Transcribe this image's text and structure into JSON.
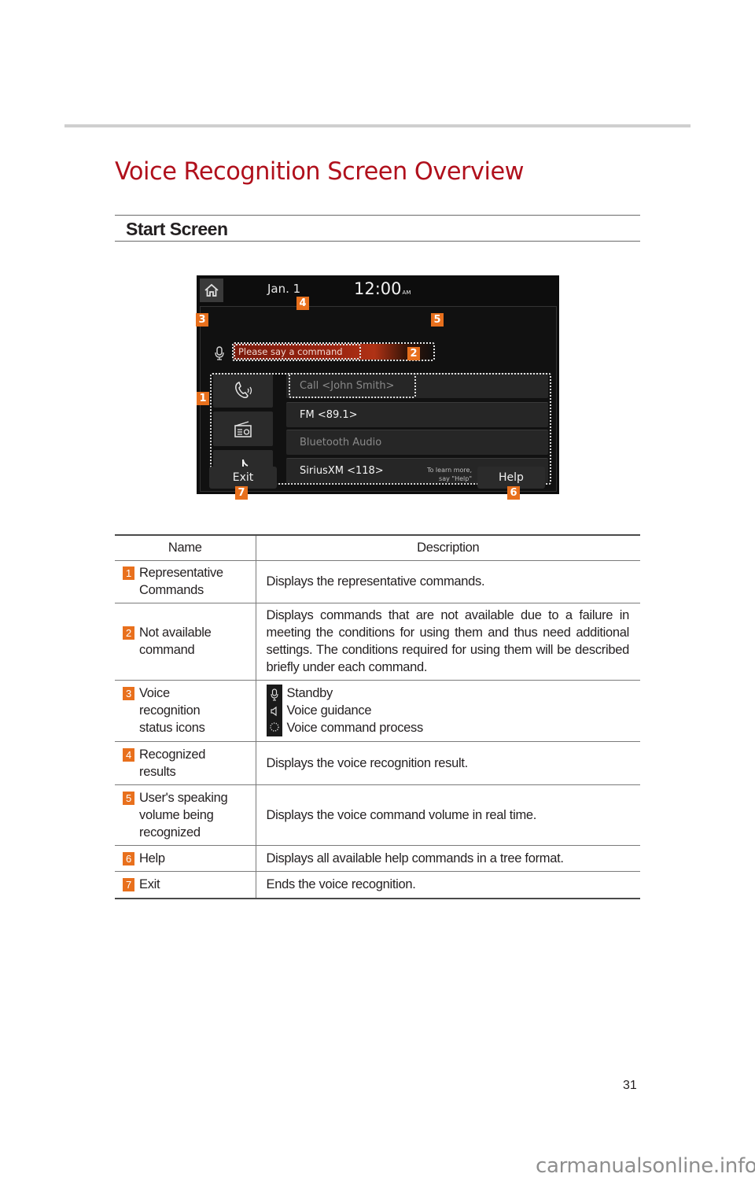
{
  "header": {
    "title": "Voice Recognition Screen Overview",
    "section": "Start Screen"
  },
  "screen": {
    "date": "Jan.  1",
    "time": "12:00",
    "ampm": "AM",
    "prompt": "Please say a command",
    "commands": [
      {
        "label": "Call <John Smith>",
        "state": "unavailable"
      },
      {
        "label": "FM <89.1>",
        "state": "available"
      },
      {
        "label": "Bluetooth Audio",
        "state": "unavailable"
      },
      {
        "label": "SiriusXM <118>",
        "state": "available"
      }
    ],
    "category_icons": [
      "phone-icon",
      "radio-icon",
      "music-note-icon"
    ],
    "exit_label": "Exit",
    "help_label": "Help",
    "hint_line1": "To learn more,",
    "hint_line2": "say \"Help\"",
    "callouts": [
      "1",
      "2",
      "3",
      "4",
      "5",
      "6",
      "7"
    ]
  },
  "table": {
    "headers": {
      "name": "Name",
      "description": "Description"
    },
    "rows": [
      {
        "num": "1",
        "name": "Representative Commands",
        "description": "Displays the representative commands."
      },
      {
        "num": "2",
        "name": "Not available command",
        "description": "Displays commands that are not available due to a failure in meeting the conditions for using them and thus need additional settings. The conditions required for using them will be described briefly under each command."
      },
      {
        "num": "3",
        "name": "Voice recognition status icons",
        "status_items": [
          {
            "icon": "microphone-icon",
            "label": "Standby"
          },
          {
            "icon": "speaker-icon",
            "label": "Voice guidance"
          },
          {
            "icon": "loading-circle-icon",
            "label": "Voice command process"
          }
        ]
      },
      {
        "num": "4",
        "name": "Recognized results",
        "description": "Displays the voice recognition result."
      },
      {
        "num": "5",
        "name": "User's speaking volume being recognized",
        "description": "Displays the voice command volume in real time."
      },
      {
        "num": "6",
        "name": "Help",
        "description": "Displays all available help commands in a tree format."
      },
      {
        "num": "7",
        "name": "Exit",
        "description": "Ends the voice recognition."
      }
    ]
  },
  "footer": {
    "page_number": "31",
    "watermark": "carmanualsonline.info"
  },
  "colors": {
    "title_red": "#b0101c",
    "callout_orange": "#e8701d"
  }
}
